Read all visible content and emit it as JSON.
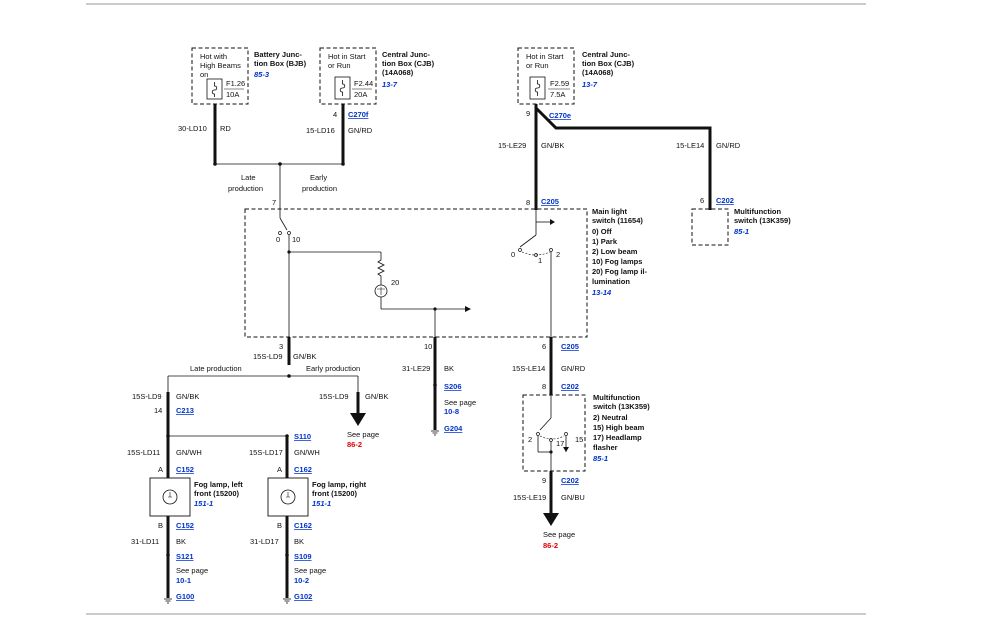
{
  "fuses": {
    "f1": {
      "note": [
        "Hot with",
        "High Beams",
        "on"
      ],
      "name": "F1.26",
      "rating": "10A",
      "box": [
        "Battery Junc-",
        "tion Box (BJB)"
      ],
      "ref": "85-3"
    },
    "f2": {
      "note": [
        "Hot in Start",
        "or Run"
      ],
      "name": "F2.44",
      "rating": "20A",
      "box": [
        "Central Junc-",
        "tion Box (CJB)",
        "(14A068)"
      ],
      "ref": "13-7"
    },
    "f3": {
      "note": [
        "Hot in Start",
        "or Run"
      ],
      "name": "F2.59",
      "rating": "7.5A",
      "box": [
        "Central Junc-",
        "tion Box (CJB)",
        "(14A068)"
      ],
      "ref": "13-7"
    }
  },
  "wires": {
    "w_30ld10": {
      "circuit": "30-LD10",
      "color": "RD"
    },
    "w_15ld16": {
      "circuit": "15-LD16",
      "color": "GN/RD",
      "pin": "4",
      "connector": "C270f"
    },
    "w_15le29": {
      "circuit": "15-LE29",
      "color": "GN/BK",
      "pin": "9",
      "connector": "C270e"
    },
    "w_15le14": {
      "circuit": "15-LE14",
      "color": "GN/RD"
    },
    "w_15sld9": {
      "circuit": "15S-LD9",
      "color": "GN/BK"
    },
    "w_31le29": {
      "circuit": "31-LE29",
      "color": "BK"
    },
    "w_15sle14": {
      "circuit": "15S-LE14",
      "color": "GN/RD"
    },
    "w_15sld9b": {
      "circuit": "15S-LD9",
      "color": "GN/BK",
      "pin": "14",
      "connector": "C213"
    },
    "w_15sld9c": {
      "circuit": "15S-LD9",
      "color": "GN/BK"
    },
    "w_15sld11": {
      "circuit": "15S-LD11",
      "color": "GN/WH"
    },
    "w_15sld17": {
      "circuit": "15S-LD17",
      "color": "GN/WH"
    },
    "w_31ld11": {
      "circuit": "31-LD11",
      "color": "BK"
    },
    "w_31ld17": {
      "circuit": "31-LD17",
      "color": "BK"
    },
    "w_15sle19": {
      "circuit": "15S-LE19",
      "color": "GN/BU"
    }
  },
  "production": {
    "late": [
      "Late",
      "production"
    ],
    "early": [
      "Early",
      "production"
    ],
    "late_single": "Late production",
    "early_single": "Early production"
  },
  "switch": {
    "pin_in": "7",
    "pos0": "0",
    "pos10": "10",
    "pos20": "20",
    "pin_c205_top": "8",
    "c205": "C205",
    "pos_0": "0",
    "pos_1": "1",
    "pos_2": "2",
    "title": [
      "Main light",
      "switch (11654)"
    ],
    "items": [
      "0)  Off",
      "1)  Park",
      "2)  Low beam",
      "10) Fog lamps",
      "20) Fog lamp il-",
      "     lumination"
    ],
    "ref": "13-14",
    "pin3": "3",
    "pin10": "10",
    "pin6": "6",
    "c205_bot": "C205"
  },
  "mf_top": {
    "pin": "6",
    "connector": "C202",
    "title": [
      "Multifunction",
      "switch (13K359)"
    ],
    "ref": "85-1"
  },
  "mf_bot": {
    "pin_top": "8",
    "connector_top": "C202",
    "title": [
      "Multifunction",
      "switch (13K359)"
    ],
    "items": [
      "2)  Neutral",
      "15) High beam",
      "17) Headlamp",
      "     flasher"
    ],
    "ref": "85-1",
    "p2": "2",
    "p15": "15",
    "p17": "17",
    "pin_bot": "9",
    "connector_bot": "C202"
  },
  "ground_center": {
    "splice": "S206",
    "see": "See page",
    "page": "10-8",
    "ground": "G204"
  },
  "fog_left": {
    "pinA": "A",
    "connA": "C152",
    "pinB": "B",
    "connB": "C152",
    "title": [
      "Fog lamp, left",
      "front (15200)"
    ],
    "ref": "151-1",
    "splice": "S121",
    "see": "See page",
    "page": "10-1",
    "ground": "G100"
  },
  "fog_right": {
    "pinA": "A",
    "connA": "C162",
    "pinB": "B",
    "connB": "C162",
    "title": [
      "Fog lamp, right",
      "front (15200)"
    ],
    "ref": "151-1",
    "splice": "S109",
    "see": "See page",
    "page": "10-2",
    "ground": "G102"
  },
  "splice_s110": "S110",
  "offpage_1": {
    "see": "See page",
    "page": "86-2"
  },
  "offpage_2": {
    "see": "See page",
    "page": "86-2"
  }
}
